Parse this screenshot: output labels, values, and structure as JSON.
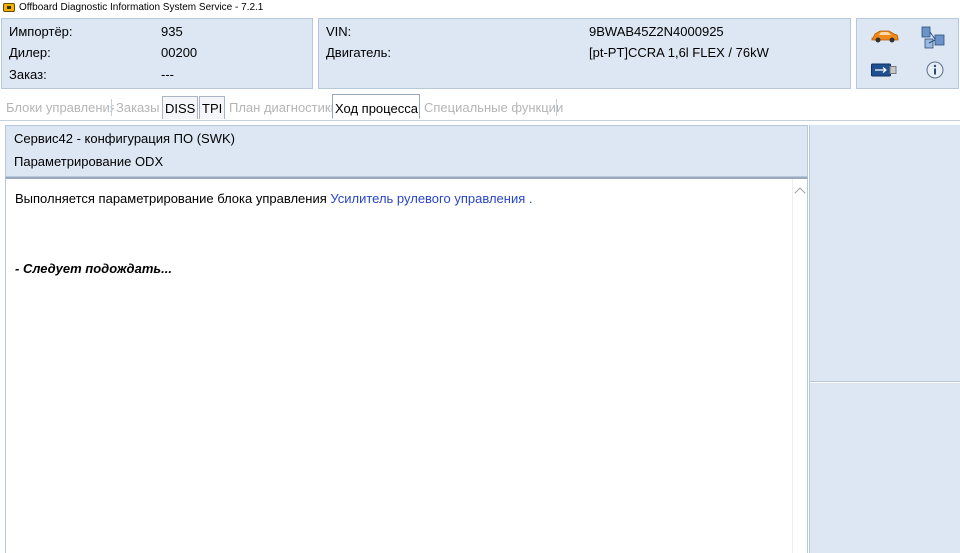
{
  "window": {
    "title": "Offboard Diagnostic Information System Service - 7.2.1"
  },
  "header": {
    "left": [
      {
        "label": "Импортёр:",
        "value": "935"
      },
      {
        "label": "Дилер:",
        "value": "00200"
      },
      {
        "label": "Заказ:",
        "value": "---"
      }
    ],
    "middle": [
      {
        "label": "VIN:",
        "value": "9BWAB45Z2N4000925"
      },
      {
        "label": "Двигатель:",
        "value": "[pt-PT]CCRA 1,6l FLEX / 76kW"
      }
    ],
    "icons": [
      "car-icon",
      "network-icon",
      "usb-icon",
      "info-icon"
    ]
  },
  "tabs": [
    {
      "label": "Блоки управления",
      "state": "disabled"
    },
    {
      "label": "Заказы",
      "state": "disabled"
    },
    {
      "label": "DISS",
      "state": "enabled"
    },
    {
      "label": "TPI",
      "state": "enabled"
    },
    {
      "label": "План диагностики",
      "state": "disabled"
    },
    {
      "label": "Ход процесса",
      "state": "active"
    },
    {
      "label": "Специальные функции",
      "state": "disabled"
    }
  ],
  "content": {
    "heading": "Сервис42 - конфигурация ПО (SWK)",
    "subheading": "Параметрирование ODX",
    "message_prefix": "Выполняется параметрирование блока управления ",
    "message_link": "Усилитель рулевого управления",
    "message_suffix": " .",
    "wait_text": "- Следует подождать..."
  },
  "colors": {
    "panel_bg": "#dde7f3",
    "panel_border": "#b8c7da",
    "link": "#2a45c9",
    "disabled_text": "#b5b5b5",
    "car_orange": "#f08a1c"
  }
}
